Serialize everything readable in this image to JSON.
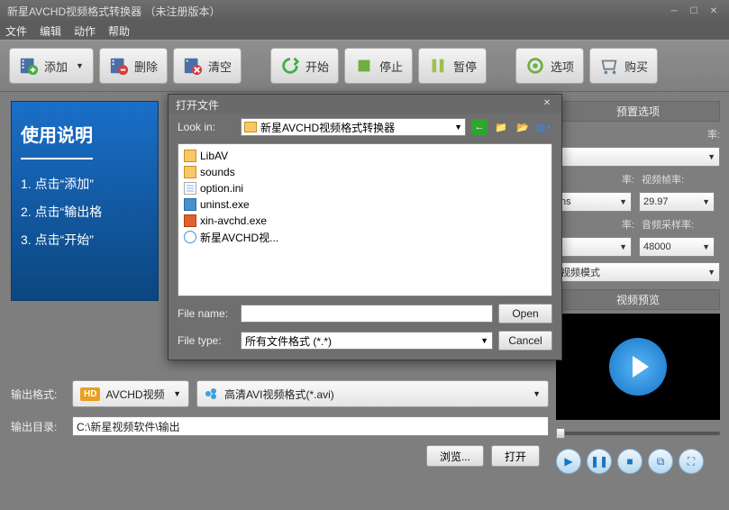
{
  "title": "新星AVCHD视频格式转换器 （未注册版本）",
  "menu": {
    "file": "文件",
    "edit": "编辑",
    "action": "动作",
    "help": "帮助"
  },
  "toolbar": {
    "add": "添加",
    "delete": "删除",
    "clear": "清空",
    "start": "开始",
    "stop": "停止",
    "pause": "暂停",
    "options": "选项",
    "buy": "购买"
  },
  "instructions": {
    "header": "使用说明",
    "step1": "1. 点击“添加”",
    "step2": "2. 点击“输出格",
    "step3": "3. 点击“开始”"
  },
  "output": {
    "format_label": "输出格式:",
    "format_badge": "HD",
    "format_text": "AVCHD视频",
    "format_detail": "高清AVI视频格式(*.avi)",
    "dir_label": "输出目录:",
    "dir_value": "C:\\新星视频软件\\输出",
    "browse": "浏览...",
    "open": "打开"
  },
  "side": {
    "preset_header": "预置选项",
    "rate_suffix": "率:",
    "fps_label": "视频帧率:",
    "fps_value": "29.97",
    "bitrate_suffix2": "率:",
    "sample_label": "音频采样率:",
    "sample_value": "48000",
    "mode_suffix": "视频模式",
    "dropdown_ns": "ns",
    "preview_header": "视频预览"
  },
  "dialog": {
    "title": "打开文件",
    "lookin_label": "Look in:",
    "lookin_value": "新星AVCHD视频格式转换器",
    "files": [
      {
        "icon": "folder",
        "name": "LibAV"
      },
      {
        "icon": "folder",
        "name": "sounds"
      },
      {
        "icon": "ini",
        "name": "option.ini"
      },
      {
        "icon": "exe",
        "name": "uninst.exe"
      },
      {
        "icon": "exe2",
        "name": "xin-avchd.exe"
      },
      {
        "icon": "ie",
        "name": "新星AVCHD视..."
      }
    ],
    "filename_label": "File name:",
    "filename_value": "",
    "filetype_label": "File type:",
    "filetype_value": "所有文件格式 (*.*)",
    "open": "Open",
    "cancel": "Cancel"
  }
}
